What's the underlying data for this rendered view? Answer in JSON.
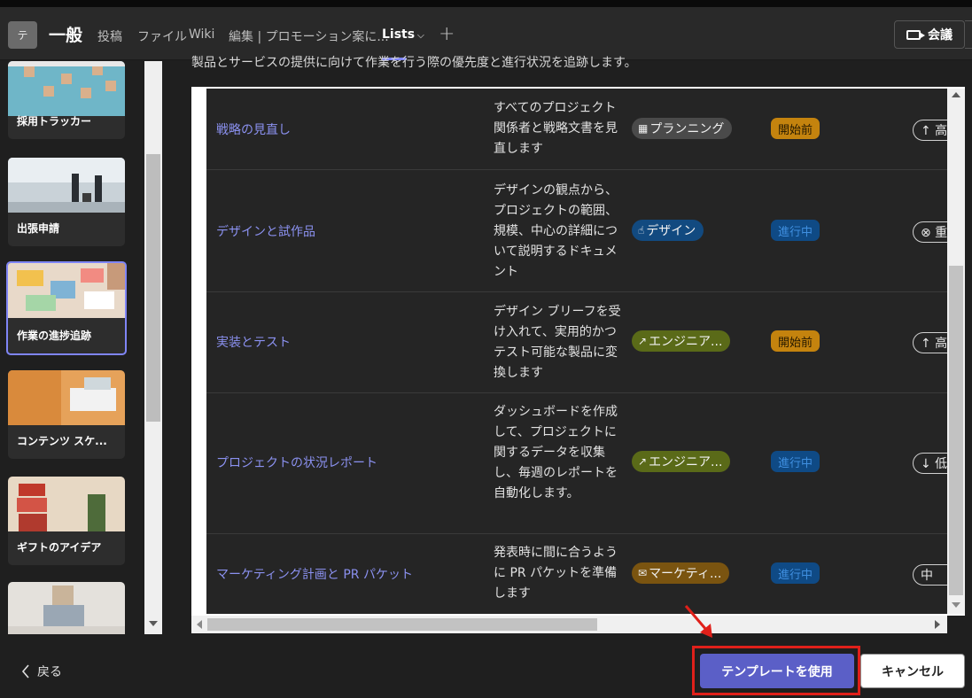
{
  "header": {
    "team_initial": "テ",
    "channel": "一般",
    "tabs": [
      {
        "label": "投稿"
      },
      {
        "label": "ファイル"
      },
      {
        "label": "Wiki"
      },
      {
        "label": "編集 | プロモーション案に..."
      },
      {
        "label": "Lists"
      }
    ],
    "meet_label": "会議"
  },
  "sidebar": {
    "templates": [
      {
        "label": "採用トラッカー"
      },
      {
        "label": "出張申請"
      },
      {
        "label": "作業の進捗追跡"
      },
      {
        "label": "コンテンツ スケ..."
      },
      {
        "label": "ギフトのアイデア"
      },
      {
        "label": ""
      }
    ]
  },
  "description": "製品とサービスの提供に向けて作業を行う際の優先度と進行状況を追跡します。",
  "rows": [
    {
      "title": "戦略の見直し",
      "desc": "すべてのプロジェクト関係者と戦略文書を見直します",
      "category": "プランニング",
      "category_icon": "calendar-icon",
      "status": "開始前",
      "priority": "↑ 高"
    },
    {
      "title": "デザインと試作品",
      "desc": "デザインの観点から、プロジェクトの範囲、規模、中心の詳細について説明するドキュメント",
      "category": "デザイン",
      "category_icon": "thumbs-up-icon",
      "status": "進行中",
      "priority": "⊗ 重"
    },
    {
      "title": "実装とテスト",
      "desc": "デザイン ブリーフを受け入れて、実用的かつテスト可能な製品に変換します",
      "category": "エンジニア...",
      "category_icon": "trend-icon",
      "status": "開始前",
      "priority": "↑ 高"
    },
    {
      "title": "プロジェクトの状況レポート",
      "desc": "ダッシュボードを作成して、プロジェクトに関するデータを収集し、毎週のレポートを自動化します。",
      "category": "エンジニア...",
      "category_icon": "trend-icon",
      "status": "進行中",
      "priority": "↓ 低"
    },
    {
      "title": "マーケティング計画と PR パケット",
      "desc": "発表時に間に合うように PR パケットを準備します",
      "category": "マーケティ...",
      "category_icon": "mail-icon",
      "status": "進行中",
      "priority": "中"
    }
  ],
  "footer": {
    "back_label": "戻る",
    "use_template_label": "テンプレートを使用",
    "cancel_label": "キャンセル"
  },
  "colors": {
    "accent": "#5b5fc7",
    "link": "#8b91f0",
    "status_not_started": "#c4830e",
    "status_in_progress": "#0f4a85",
    "cat_planning": "#4a4a4a",
    "cat_design": "#124a80",
    "cat_engineering": "#5a6a18",
    "cat_marketing": "#7a5410",
    "highlight": "#e0201a"
  }
}
